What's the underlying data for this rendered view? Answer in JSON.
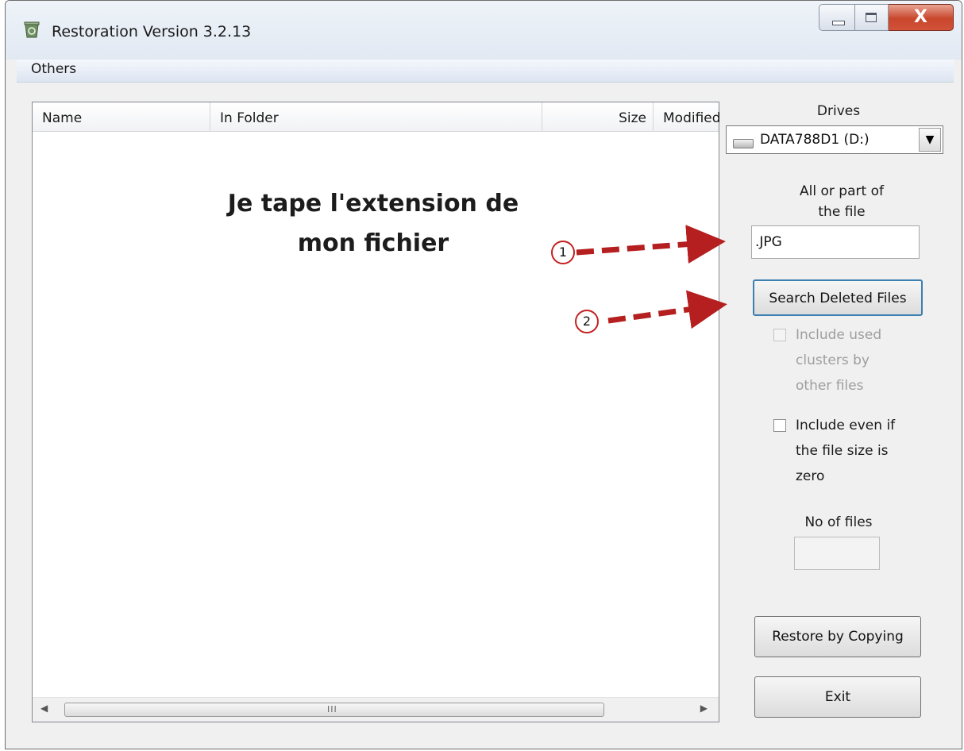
{
  "window": {
    "title": "Restoration Version 3.2.13",
    "close_glyph": "X"
  },
  "menu": {
    "others": "Others"
  },
  "list": {
    "columns": [
      "Name",
      "In Folder",
      "Size",
      "Modified"
    ],
    "scroll_grip": "III"
  },
  "annotation": {
    "line1": "Je tape l'extension de",
    "line2": "mon fichier",
    "marker1": "1",
    "marker2": "2",
    "arrow_color": "#b51f1f"
  },
  "panel": {
    "drives_label": "Drives",
    "drive_selected": "DATA788D1 (D:)",
    "file_label_line1": "All or part of",
    "file_label_line2": "the file",
    "file_value": ".JPG",
    "search_button": "Search Deleted Files",
    "include_used": [
      "Include used",
      "clusters by",
      "other files"
    ],
    "include_zero": [
      "Include even if",
      "the file size is",
      "zero"
    ],
    "no_of_files_label": "No of files",
    "restore_button": "Restore by Copying",
    "exit_button": "Exit"
  }
}
